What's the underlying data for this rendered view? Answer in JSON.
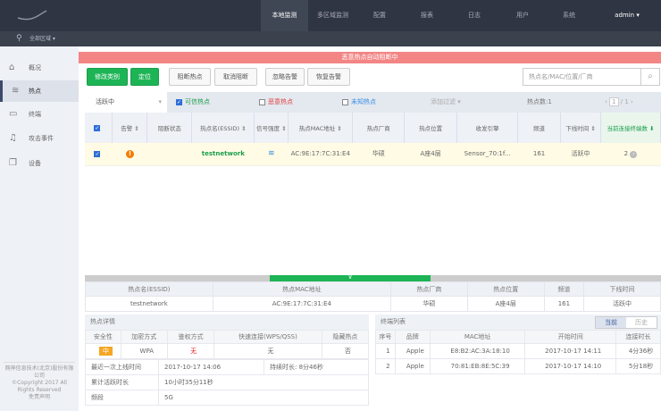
{
  "nav": {
    "items": [
      "本地监测",
      "多区域监测",
      "配置",
      "报表",
      "日志",
      "用户",
      "系统"
    ],
    "user": "admin ▾"
  },
  "region": "全部区域 ▾",
  "sidebar": {
    "items": [
      "概况",
      "热点",
      "终端",
      "攻击事件",
      "设备"
    ],
    "footer": [
      "网神信息技术(北京)股份有限公司",
      "©Copyright 2017 All",
      "Rights Reserved",
      "免责声明"
    ]
  },
  "banner": "恶意热点自动阻断中",
  "toolbar": {
    "buttons": [
      "修改类别",
      "定位",
      "阻断热点",
      "取消阻断",
      "忽略告警",
      "恢复告警"
    ],
    "search_placeholder": "热点名/MAC/位置/厂商"
  },
  "filter": {
    "status": "活跃中",
    "trusted": "可信热点",
    "malicious": "恶意热点",
    "unknown": "未知热点",
    "add": "添加过滤 ▾",
    "count": "热点数:1",
    "page": "1",
    "pages": "/ 1"
  },
  "table": {
    "headers": [
      "告警 ⇕",
      "阻断状态",
      "热点名(ESSID) ⇕",
      "信号强度 ⇕",
      "热点MAC地址 ⇕",
      "热点厂商",
      "热点位置",
      "收发引擎",
      "频道",
      "下线时间 ⇕",
      "当前连接终端数 ⬇"
    ],
    "rows": [
      {
        "name": "testnetwork",
        "mac": "AC:9E:17:7C:31:E4",
        "vendor": "华硕",
        "location": "A座4层",
        "engine": "Sensor_70:1f...",
        "channel": "161",
        "offline": "活跃中",
        "clients": "2"
      }
    ]
  },
  "summary": {
    "headers": [
      "热点名(ESSID)",
      "热点MAC地址",
      "热点厂商",
      "热点位置",
      "频道",
      "下线时间"
    ],
    "values": [
      "testnetwork",
      "AC:9E:17:7C:31:E4",
      "华硕",
      "A座4层",
      "161",
      "活跃中"
    ]
  },
  "details": {
    "title": "热点详情",
    "headers": [
      "安全性",
      "加密方式",
      "鉴权方式",
      "快速连接(WPS/QSS)",
      "隐藏热点"
    ],
    "values": [
      "中",
      "WPA",
      "无",
      "无",
      "否"
    ],
    "last_online_label": "最近一次上线时间",
    "last_online": "2017-10-17 14:06",
    "duration": "持续时长: 8分46秒",
    "total_label": "累计活跃时长",
    "total": "10小时35分11秒",
    "band_label": "频段",
    "band": "5G"
  },
  "clients": {
    "title": "终端列表",
    "tab_current": "当前",
    "tab_history": "历史",
    "headers": [
      "序号",
      "品牌",
      "MAC地址",
      "开始时间",
      "连接时长"
    ],
    "rows": [
      [
        "1",
        "Apple",
        "E8:B2:AC:3A:18:10",
        "2017-10-17 14:11",
        "4分36秒"
      ],
      [
        "2",
        "Apple",
        "70:81:EB:8E:5C:39",
        "2017-10-17 14:10",
        "5分18秒"
      ]
    ]
  }
}
